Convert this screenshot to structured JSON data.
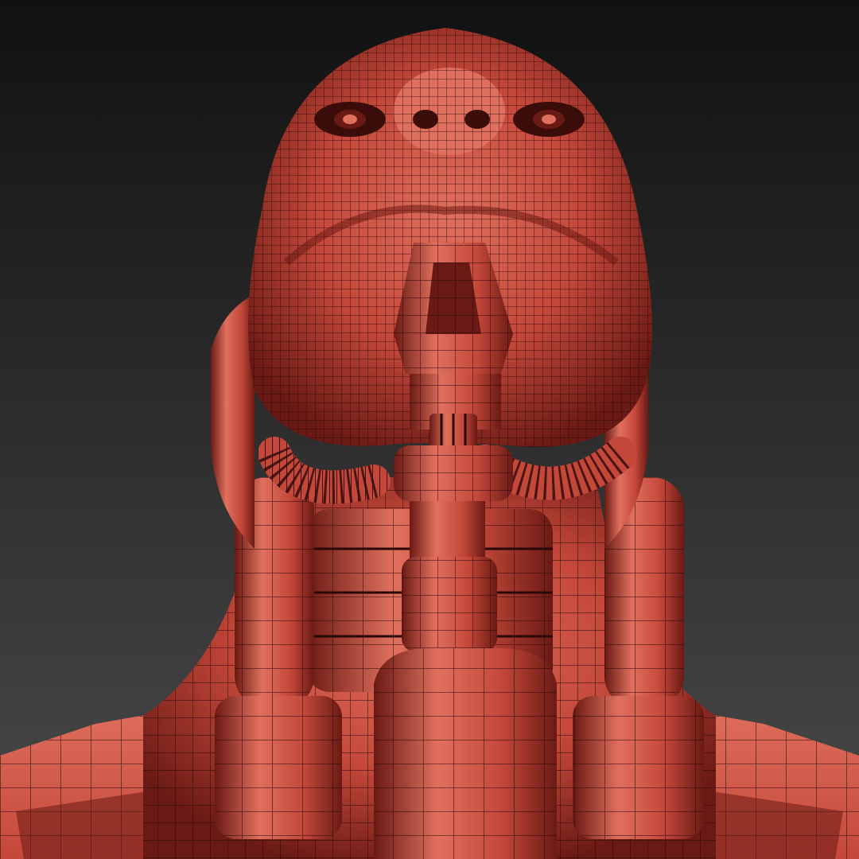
{
  "viewport": {
    "background_top": "#111111",
    "background_bottom": "#4a4a4a"
  },
  "model": {
    "base_color": "#c4483a",
    "light_color": "#e0705e",
    "shadow_color": "#6a1a14",
    "deep_shadow_color": "#3a0c0a",
    "wire_color": "#2a0808",
    "display_mode": "wireframe-on-shaded"
  }
}
